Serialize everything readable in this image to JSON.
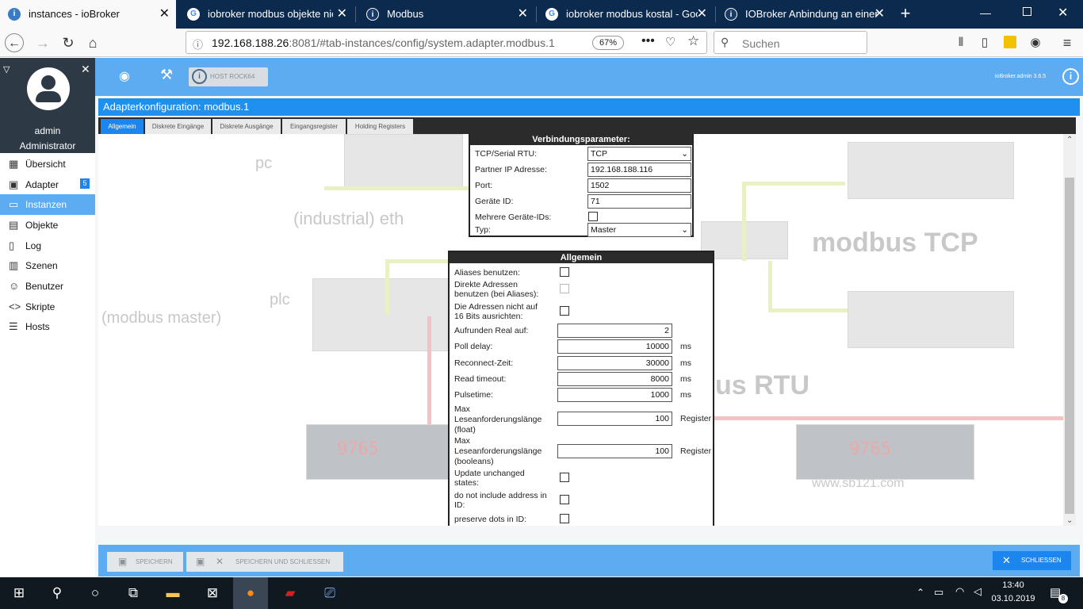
{
  "browser": {
    "tabs": [
      {
        "title": "instances - ioBroker",
        "active": true
      },
      {
        "title": "iobroker modbus objekte nicht",
        "active": false
      },
      {
        "title": "Modbus",
        "active": false
      },
      {
        "title": "iobroker modbus kostal - Goog",
        "active": false
      },
      {
        "title": "IOBroker Anbindung an einen I",
        "active": false
      }
    ],
    "url_host": "192.168.188.26",
    "url_rest": ":8081/#tab-instances/config/system.adapter.modbus.1",
    "zoom": "67%",
    "search_placeholder": "Suchen"
  },
  "app": {
    "host_button": "HOST ROCK64",
    "version": "ioBroker.admin 3.6.5"
  },
  "user": {
    "name": "admin",
    "role": "Administrator"
  },
  "sidebar": {
    "items": [
      {
        "label": "Übersicht",
        "icon": "grid-icon"
      },
      {
        "label": "Adapter",
        "icon": "cart-icon",
        "badge": "5"
      },
      {
        "label": "Instanzen",
        "icon": "instances-icon",
        "active": true
      },
      {
        "label": "Objekte",
        "icon": "list-icon"
      },
      {
        "label": "Log",
        "icon": "log-icon"
      },
      {
        "label": "Szenen",
        "icon": "scenes-icon"
      },
      {
        "label": "Benutzer",
        "icon": "user-icon"
      },
      {
        "label": "Skripte",
        "icon": "code-icon"
      },
      {
        "label": "Hosts",
        "icon": "hosts-icon"
      }
    ]
  },
  "adapter": {
    "title": "Adapterkonfiguration: modbus.1",
    "tabs": [
      "Allgemein",
      "Diskrete Eingänge",
      "Diskrete Ausgänge",
      "Eingangsregister",
      "Holding Registers"
    ]
  },
  "background_picture": {
    "texts": [
      "pc",
      "(industrial) eth",
      "plc",
      "(modbus master)",
      "modbus TCP",
      "us RTU",
      "9765",
      "www.sb121.com"
    ]
  },
  "connection": {
    "title": "Verbindungsparameter:",
    "type_label": "TCP/Serial RTU:",
    "type_value": "TCP",
    "ip_label": "Partner IP Adresse:",
    "ip_value": "192.168.188.116",
    "port_label": "Port:",
    "port_value": "1502",
    "device_label": "Geräte ID:",
    "device_value": "71",
    "multi_label": "Mehrere Geräte-IDs:",
    "typ_label": "Typ:",
    "typ_value": "Master"
  },
  "general": {
    "title": "Allgemein",
    "aliases_label": "Aliases benutzen:",
    "direct_label_1": "Direkte Adressen",
    "direct_label_2": "benutzen (bei Aliases):",
    "align_label_1": "Die Adressen nicht auf",
    "align_label_2": "16 Bits ausrichten:",
    "round_label": "Aufrunden Real auf:",
    "round_value": "2",
    "poll_label": "Poll delay:",
    "poll_value": "10000",
    "poll_unit": "ms",
    "reconnect_label": "Reconnect-Zeit:",
    "reconnect_value": "30000",
    "reconnect_unit": "ms",
    "timeout_label": "Read timeout:",
    "timeout_value": "8000",
    "timeout_unit": "ms",
    "pulse_label": "Pulsetime:",
    "pulse_value": "1000",
    "pulse_unit": "ms",
    "maxf_label_1": "Max",
    "maxf_label_2": "Leseanforderungslänge",
    "maxf_label_3": "(float)",
    "maxf_value": "100",
    "maxf_unit": "Register",
    "maxb_label_1": "Max",
    "maxb_label_2": "Leseanforderungslänge",
    "maxb_label_3": "(booleans)",
    "maxb_value": "100",
    "maxb_unit": "Register",
    "upd_label_1": "Update unchanged",
    "upd_label_2": "states:",
    "noaddr_label_1": "do not include address in",
    "noaddr_label_2": "ID:",
    "dots_label": "preserve dots in ID:"
  },
  "footer": {
    "save": "SPEICHERN",
    "save_close": "SPEICHERN UND SCHLIESSEN",
    "close": "SCHLIESSEN"
  },
  "taskbar": {
    "time": "13:40",
    "date": "03.10.2019",
    "notifications": "8"
  }
}
